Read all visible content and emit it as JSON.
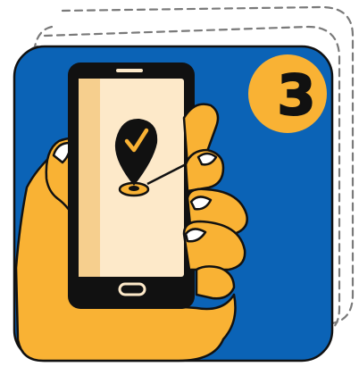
{
  "badge": {
    "number": "3"
  },
  "colors": {
    "panel_blue": "#0b63b6",
    "accent_yellow": "#f9b234",
    "screen_cream": "#fde9c9",
    "outline_black": "#111111",
    "dash_gray": "#7a7a7a"
  },
  "icons": {
    "pin": "map-pin-checkmark-icon",
    "hand": "hand-holding-phone",
    "phone": "smartphone"
  }
}
